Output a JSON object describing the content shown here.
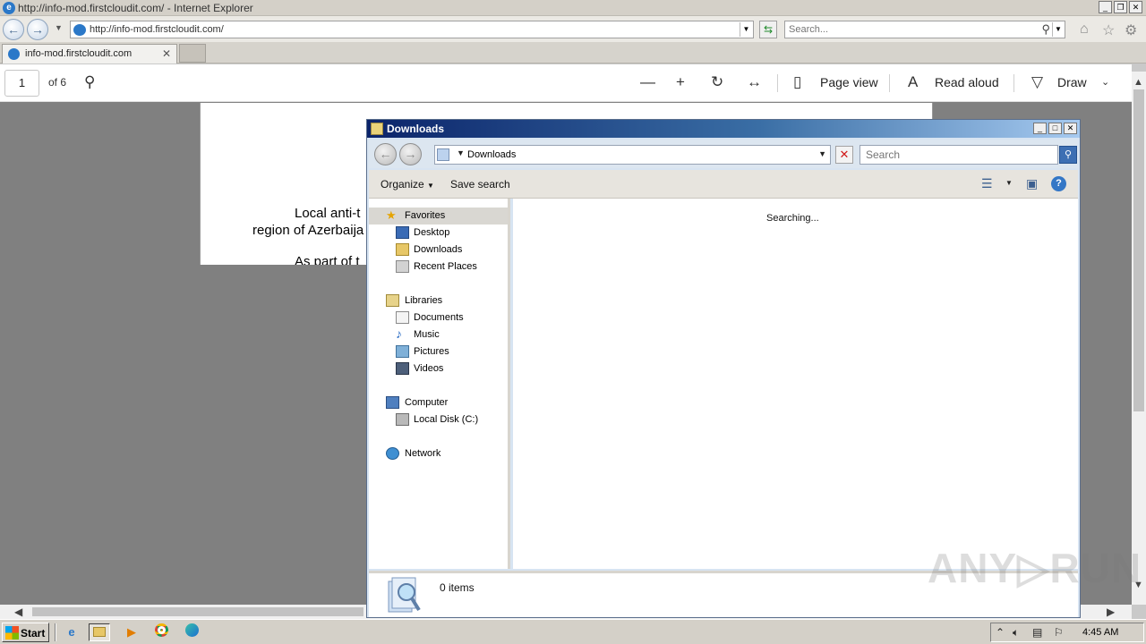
{
  "browser": {
    "title": "http://info-mod.firstcloudit.com/ - Internet Explorer",
    "address": "http://info-mod.firstcloudit.com/",
    "search_placeholder": "Search...",
    "tab_label": "info-mod.firstcloudit.com"
  },
  "pdf_toolbar": {
    "page_number": "1",
    "page_of": "of 6",
    "page_view_label": "Page view",
    "read_aloud_label": "Read aloud",
    "draw_label": "Draw"
  },
  "document": {
    "line1": "Local  anti-t",
    "line2": "region of Azerbaija",
    "line3": "As part of t"
  },
  "explorer": {
    "title": "Downloads",
    "path": "Downloads",
    "search_placeholder": "Search",
    "organize_label": "Organize",
    "save_search_label": "Save search",
    "favorites": "Favorites",
    "favorite_items": [
      "Desktop",
      "Downloads",
      "Recent Places"
    ],
    "libraries": "Libraries",
    "library_items": [
      "Documents",
      "Music",
      "Pictures",
      "Videos"
    ],
    "computer": "Computer",
    "computer_items": [
      "Local Disk (C:)"
    ],
    "network": "Network",
    "status": "Searching...",
    "items_count": "0 items"
  },
  "watermark": "ANY▷RUN",
  "taskbar": {
    "start_label": "Start",
    "clock": "4:45 AM"
  },
  "colors": {
    "explorer_title_start": "#0b246a",
    "explorer_title_end": "#a6caf0",
    "doc_background": "#808080",
    "selected_nav": "#d9d7d2"
  }
}
